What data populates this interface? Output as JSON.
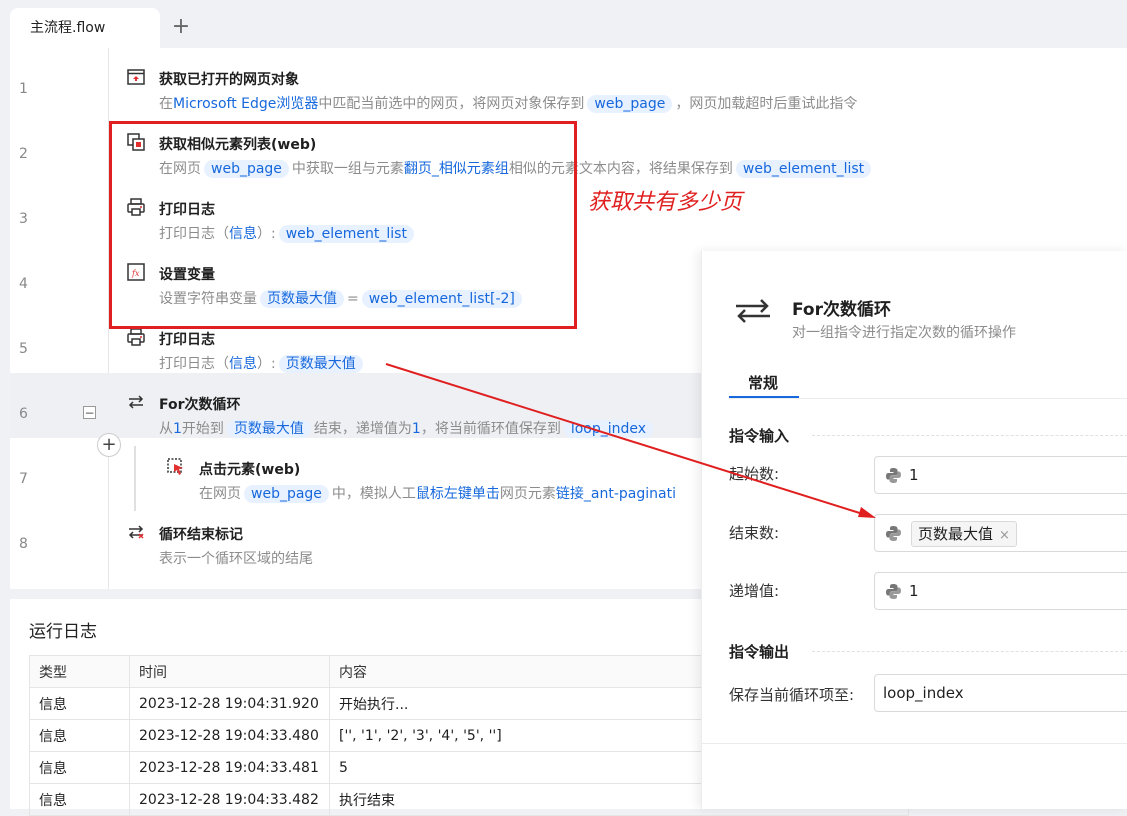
{
  "tabs": {
    "active_label": "主流程.flow",
    "add_label": "+"
  },
  "flow": {
    "steps": [
      {
        "line": "1",
        "title": "获取已打开的网页对象",
        "desc": {
          "p1": "在",
          "k1": "Microsoft Edge浏览器",
          "p2": "中匹配当前选中的网页，将网页对象保存到",
          "c1": "web_page",
          "p3": "，网页加载超时后重试此指令"
        }
      },
      {
        "line": "2",
        "title": "获取相似元素列表(web)",
        "desc": {
          "p1": "在网页",
          "c1": "web_page",
          "p2": "中获取一组与元素",
          "k1": "翻页_相似元素组",
          "p3": "相似的元素文本内容，将结果保存到",
          "c2": "web_element_list"
        }
      },
      {
        "line": "3",
        "title": "打印日志",
        "desc": {
          "p1": "打印日志（",
          "k1": "信息",
          "p2": "）:",
          "c1": "web_element_list"
        }
      },
      {
        "line": "4",
        "title": "设置变量",
        "desc": {
          "p1": "设置字符串变量",
          "c1": "页数最大值",
          "p2": "=",
          "c2": "web_element_list[-2]"
        }
      },
      {
        "line": "5",
        "title": "打印日志",
        "desc": {
          "p1": "打印日志（",
          "k1": "信息",
          "p2": "）:",
          "c1": "页数最大值"
        }
      },
      {
        "line": "6",
        "title": "For次数循环",
        "desc": {
          "p1": "从",
          "k1": "1",
          "p2": "开始到",
          "c1": "页数最大值",
          "p3": "结束，递增值为",
          "k2": "1",
          "p4": "，将当前循环值保存到",
          "c2": "loop_index"
        }
      },
      {
        "line": "7",
        "title": "点击元素(web)",
        "desc": {
          "p1": "在网页",
          "c1": "web_page",
          "p2": "中，模拟人工",
          "k1": "鼠标左键单击",
          "p3": "网页元素",
          "k2": "链接_ant-paginati"
        }
      },
      {
        "line": "8",
        "title": "循环结束标记",
        "desc": {
          "p1": "表示一个循环区域的结尾"
        }
      }
    ],
    "collapse_label": "−",
    "add_step_label": "+"
  },
  "annotation": {
    "text": "获取共有多少页",
    "color": "#e02020"
  },
  "log": {
    "title": "运行日志",
    "columns": [
      "类型",
      "时间",
      "内容"
    ],
    "rows": [
      [
        "信息",
        "2023-12-28 19:04:31.920",
        "开始执行..."
      ],
      [
        "信息",
        "2023-12-28 19:04:33.480",
        "['', '1', '2', '3', '4', '5', '']"
      ],
      [
        "信息",
        "2023-12-28 19:04:33.481",
        "5"
      ],
      [
        "信息",
        "2023-12-28 19:04:33.482",
        "执行结束"
      ]
    ]
  },
  "properties": {
    "title": "For次数循环",
    "subtitle": "对一组指令进行指定次数的循环操作",
    "tab_label": "常规",
    "input_section": "指令输入",
    "output_section": "指令输出",
    "start_label": "起始数:",
    "start_value": "1",
    "end_label": "结束数:",
    "end_value": "页数最大值",
    "end_remove": "×",
    "step_label": "递增值:",
    "step_value": "1",
    "save_label": "保存当前循环项至:",
    "save_value": "loop_index"
  },
  "colors": {
    "accent": "#1668dc",
    "chip_bg": "#e8f1ff",
    "annotation": "#e02020"
  }
}
